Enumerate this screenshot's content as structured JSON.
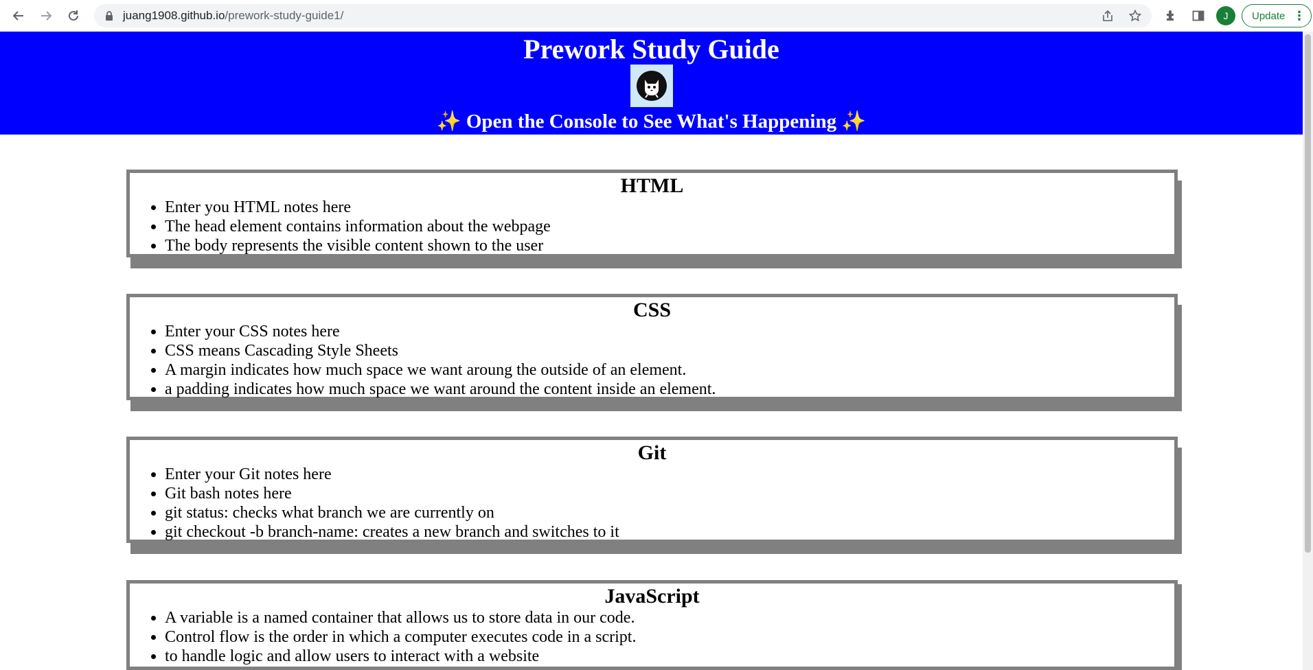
{
  "browser": {
    "url_host": "juang1908.github.io",
    "url_path": "/prework-study-guide1/",
    "avatar_letter": "J",
    "update_label": "Update",
    "icons": [
      "back-icon",
      "forward-icon",
      "reload-icon",
      "lock-icon",
      "share-icon",
      "star-icon",
      "extensions-icon",
      "side-panel-icon",
      "menu-dots-icon"
    ]
  },
  "header": {
    "title": "Prework Study Guide",
    "subtitle_text": "Open the Console to See What's Happening",
    "sparkle": "✨",
    "background": "#0000ff"
  },
  "sections": [
    {
      "title": "HTML",
      "items": [
        "Enter you HTML notes here",
        "The head element contains information about the webpage",
        "The body represents the visible content shown to the user"
      ]
    },
    {
      "title": "CSS",
      "items": [
        "Enter your CSS notes here",
        "CSS means Cascading Style Sheets",
        "A margin indicates how much space we want aroung the outside of an element.",
        "a padding indicates how much space we want around the content inside an element."
      ]
    },
    {
      "title": "Git",
      "items": [
        "Enter your Git notes here",
        "Git bash notes here",
        "git status: checks what branch we are currently on",
        "git checkout -b branch-name: creates a new branch and switches to it"
      ]
    },
    {
      "title": "JavaScript",
      "items": [
        "A variable is a named container that allows us to store data in our code.",
        "Control flow is the order in which a computer executes code in a script.",
        "to handle logic and allow users to interact with a website"
      ]
    }
  ]
}
